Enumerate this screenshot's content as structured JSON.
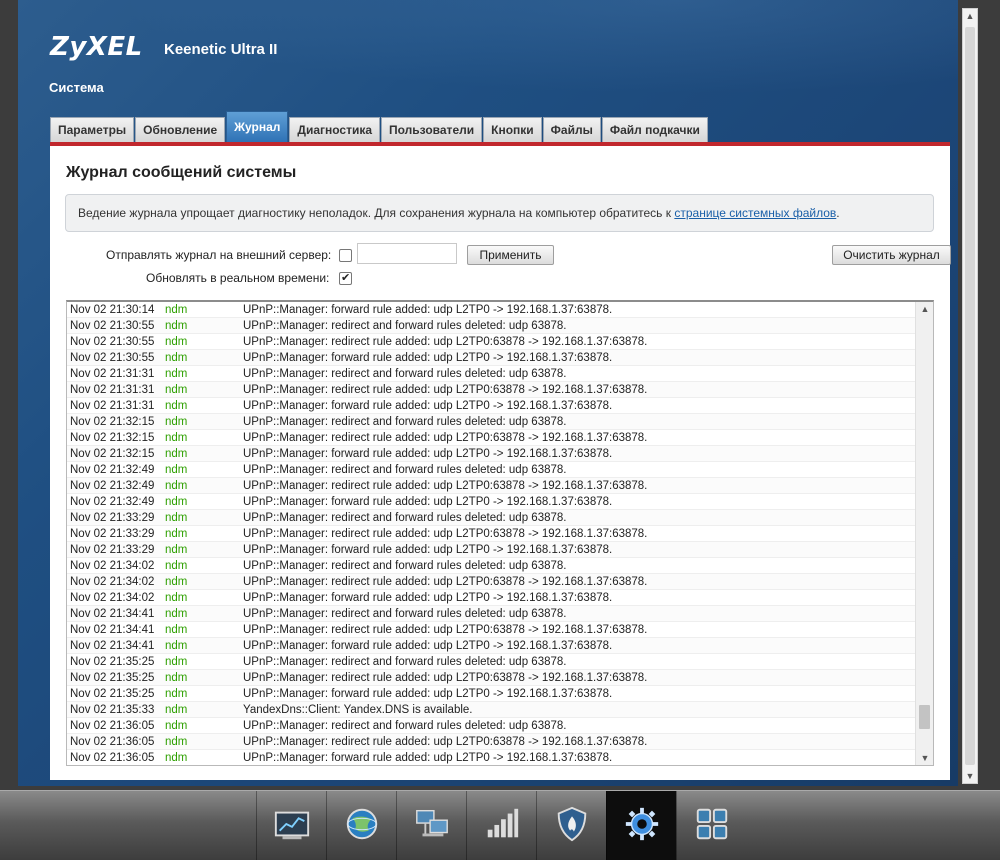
{
  "brand": {
    "logo": "ZyXEL",
    "model": "Keenetic Ultra II"
  },
  "section_title": "Система",
  "tabs": [
    {
      "label": "Параметры",
      "active": false
    },
    {
      "label": "Обновление",
      "active": false
    },
    {
      "label": "Журнал",
      "active": true
    },
    {
      "label": "Диагностика",
      "active": false
    },
    {
      "label": "Пользователи",
      "active": false
    },
    {
      "label": "Кнопки",
      "active": false
    },
    {
      "label": "Файлы",
      "active": false
    },
    {
      "label": "Файл подкачки",
      "active": false
    }
  ],
  "content": {
    "title": "Журнал сообщений системы",
    "info_text": "Ведение журнала упрощает диагностику неполадок. Для сохранения журнала на компьютер обратитесь к ",
    "info_link": "странице системных файлов",
    "info_tail": "."
  },
  "controls": {
    "remote_label": "Отправлять журнал на внешний сервер:",
    "remote_checked": false,
    "server_value": "",
    "apply_button": "Применить",
    "clear_button": "Очистить журнал",
    "realtime_label": "Обновлять в реальном времени:",
    "realtime_checked": true
  },
  "log": [
    {
      "time": "Nov 02 21:30:14",
      "source": "ndm",
      "message": "UPnP::Manager: forward rule added: udp L2TP0 -> 192.168.1.37:63878."
    },
    {
      "time": "Nov 02 21:30:55",
      "source": "ndm",
      "message": "UPnP::Manager: redirect and forward rules deleted: udp 63878."
    },
    {
      "time": "Nov 02 21:30:55",
      "source": "ndm",
      "message": "UPnP::Manager: redirect rule added: udp L2TP0:63878 -> 192.168.1.37:63878."
    },
    {
      "time": "Nov 02 21:30:55",
      "source": "ndm",
      "message": "UPnP::Manager: forward rule added: udp L2TP0 -> 192.168.1.37:63878."
    },
    {
      "time": "Nov 02 21:31:31",
      "source": "ndm",
      "message": "UPnP::Manager: redirect and forward rules deleted: udp 63878."
    },
    {
      "time": "Nov 02 21:31:31",
      "source": "ndm",
      "message": "UPnP::Manager: redirect rule added: udp L2TP0:63878 -> 192.168.1.37:63878."
    },
    {
      "time": "Nov 02 21:31:31",
      "source": "ndm",
      "message": "UPnP::Manager: forward rule added: udp L2TP0 -> 192.168.1.37:63878."
    },
    {
      "time": "Nov 02 21:32:15",
      "source": "ndm",
      "message": "UPnP::Manager: redirect and forward rules deleted: udp 63878."
    },
    {
      "time": "Nov 02 21:32:15",
      "source": "ndm",
      "message": "UPnP::Manager: redirect rule added: udp L2TP0:63878 -> 192.168.1.37:63878."
    },
    {
      "time": "Nov 02 21:32:15",
      "source": "ndm",
      "message": "UPnP::Manager: forward rule added: udp L2TP0 -> 192.168.1.37:63878."
    },
    {
      "time": "Nov 02 21:32:49",
      "source": "ndm",
      "message": "UPnP::Manager: redirect and forward rules deleted: udp 63878."
    },
    {
      "time": "Nov 02 21:32:49",
      "source": "ndm",
      "message": "UPnP::Manager: redirect rule added: udp L2TP0:63878 -> 192.168.1.37:63878."
    },
    {
      "time": "Nov 02 21:32:49",
      "source": "ndm",
      "message": "UPnP::Manager: forward rule added: udp L2TP0 -> 192.168.1.37:63878."
    },
    {
      "time": "Nov 02 21:33:29",
      "source": "ndm",
      "message": "UPnP::Manager: redirect and forward rules deleted: udp 63878."
    },
    {
      "time": "Nov 02 21:33:29",
      "source": "ndm",
      "message": "UPnP::Manager: redirect rule added: udp L2TP0:63878 -> 192.168.1.37:63878."
    },
    {
      "time": "Nov 02 21:33:29",
      "source": "ndm",
      "message": "UPnP::Manager: forward rule added: udp L2TP0 -> 192.168.1.37:63878."
    },
    {
      "time": "Nov 02 21:34:02",
      "source": "ndm",
      "message": "UPnP::Manager: redirect and forward rules deleted: udp 63878."
    },
    {
      "time": "Nov 02 21:34:02",
      "source": "ndm",
      "message": "UPnP::Manager: redirect rule added: udp L2TP0:63878 -> 192.168.1.37:63878."
    },
    {
      "time": "Nov 02 21:34:02",
      "source": "ndm",
      "message": "UPnP::Manager: forward rule added: udp L2TP0 -> 192.168.1.37:63878."
    },
    {
      "time": "Nov 02 21:34:41",
      "source": "ndm",
      "message": "UPnP::Manager: redirect and forward rules deleted: udp 63878."
    },
    {
      "time": "Nov 02 21:34:41",
      "source": "ndm",
      "message": "UPnP::Manager: redirect rule added: udp L2TP0:63878 -> 192.168.1.37:63878."
    },
    {
      "time": "Nov 02 21:34:41",
      "source": "ndm",
      "message": "UPnP::Manager: forward rule added: udp L2TP0 -> 192.168.1.37:63878."
    },
    {
      "time": "Nov 02 21:35:25",
      "source": "ndm",
      "message": "UPnP::Manager: redirect and forward rules deleted: udp 63878."
    },
    {
      "time": "Nov 02 21:35:25",
      "source": "ndm",
      "message": "UPnP::Manager: redirect rule added: udp L2TP0:63878 -> 192.168.1.37:63878."
    },
    {
      "time": "Nov 02 21:35:25",
      "source": "ndm",
      "message": "UPnP::Manager: forward rule added: udp L2TP0 -> 192.168.1.37:63878."
    },
    {
      "time": "Nov 02 21:35:33",
      "source": "ndm",
      "message": "YandexDns::Client: Yandex.DNS is available."
    },
    {
      "time": "Nov 02 21:36:05",
      "source": "ndm",
      "message": "UPnP::Manager: redirect and forward rules deleted: udp 63878."
    },
    {
      "time": "Nov 02 21:36:05",
      "source": "ndm",
      "message": "UPnP::Manager: redirect rule added: udp L2TP0:63878 -> 192.168.1.37:63878."
    },
    {
      "time": "Nov 02 21:36:05",
      "source": "ndm",
      "message": "UPnP::Manager: forward rule added: udp L2TP0 -> 192.168.1.37:63878."
    }
  ],
  "log_scroll_position": 0.94,
  "taskbar": [
    {
      "icon": "chart-icon",
      "active": false
    },
    {
      "icon": "globe-icon",
      "active": false
    },
    {
      "icon": "network-computers-icon",
      "active": false
    },
    {
      "icon": "signal-bars-icon",
      "active": false
    },
    {
      "icon": "shield-flame-icon",
      "active": false
    },
    {
      "icon": "gear-icon",
      "active": true
    },
    {
      "icon": "apps-grid-icon",
      "active": false
    }
  ],
  "colors": {
    "accent_red": "#c1272d",
    "tab_active": "#2f72b5",
    "source_green": "#2ea000",
    "link": "#1a5fa8"
  }
}
